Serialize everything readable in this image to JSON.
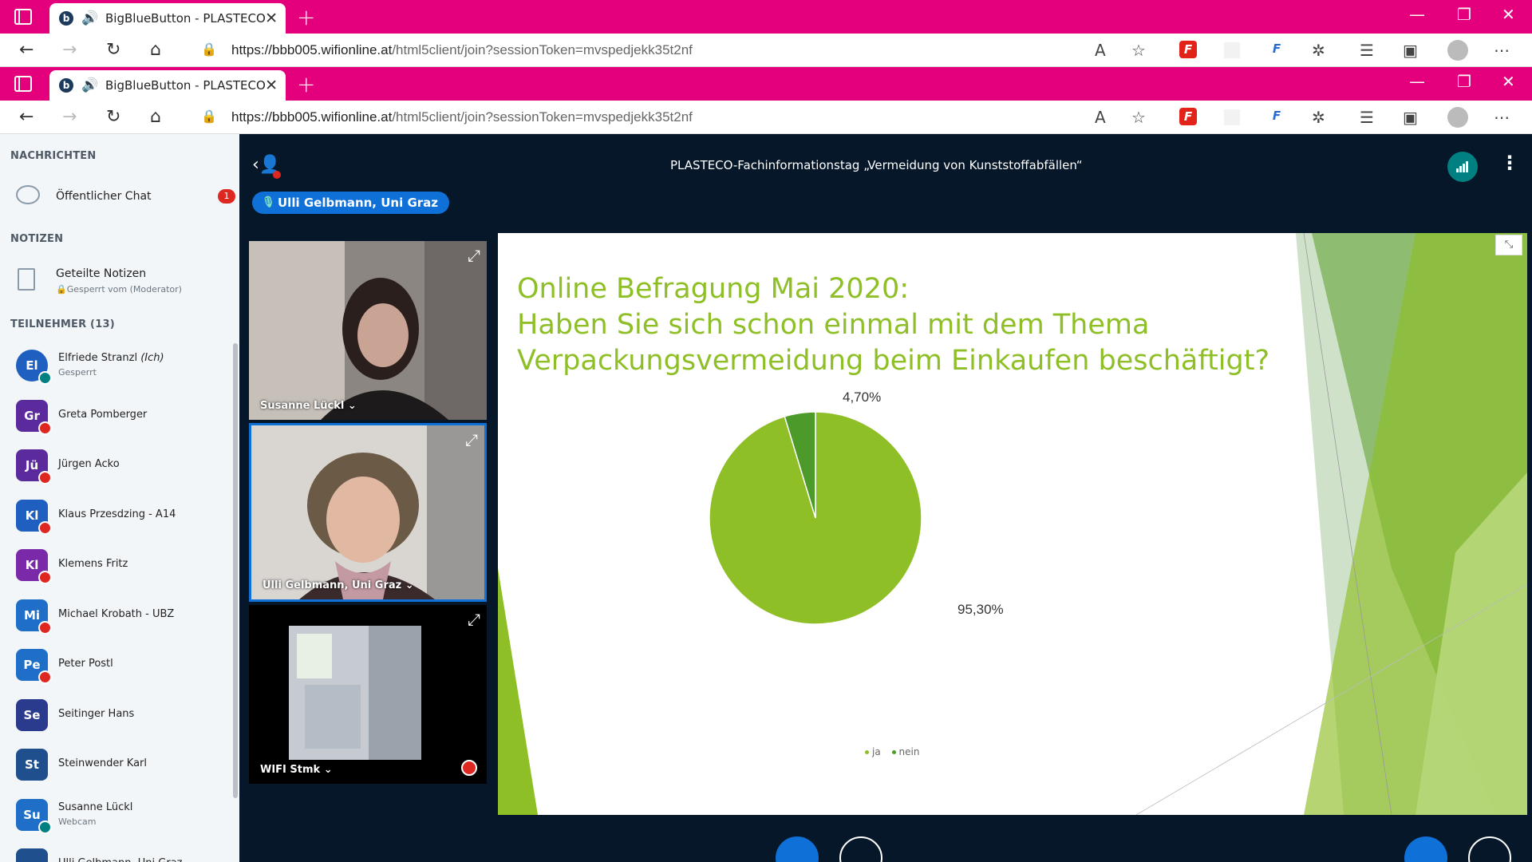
{
  "browser": {
    "tab_title": "BigBlueButton - PLASTECO-",
    "favicon_letter": "b",
    "url_domain": "https://bbb005.wifionline.at",
    "url_path": "/html5client/join?sessionToken=mvspedjekk35t2nf"
  },
  "sidebar": {
    "messages_heading": "NACHRICHTEN",
    "public_chat_label": "Öffentlicher Chat",
    "public_chat_unread": "1",
    "notes_heading": "NOTIZEN",
    "shared_notes_label": "Geteilte Notizen",
    "shared_notes_status": "Gesperrt vom (Moderator)",
    "participants_heading": "TEILNEHMER (13)",
    "participants": [
      {
        "initials": "El",
        "name": "Elfriede Stranzl",
        "suffix": " (Ich)",
        "sub": "Gesperrt",
        "color": "#1f5fbf",
        "shape": "circle",
        "badge": "talk"
      },
      {
        "initials": "Gr",
        "name": "Greta Pomberger",
        "sub": "",
        "color": "#5b2a9c",
        "shape": "square",
        "badge": "mute"
      },
      {
        "initials": "Jü",
        "name": "Jürgen Acko",
        "sub": "",
        "color": "#5b2a9c",
        "shape": "square",
        "badge": "mute"
      },
      {
        "initials": "Kl",
        "name": "Klaus Przesdzing - A14",
        "sub": "",
        "color": "#1f5fbf",
        "shape": "square",
        "badge": "mute"
      },
      {
        "initials": "Kl",
        "name": "Klemens Fritz",
        "sub": "",
        "color": "#7a2aa8",
        "shape": "square",
        "badge": "mute"
      },
      {
        "initials": "Mi",
        "name": "Michael Krobath - UBZ",
        "sub": "",
        "color": "#1f6fc9",
        "shape": "square",
        "badge": "mute"
      },
      {
        "initials": "Pe",
        "name": "Peter Postl",
        "sub": "",
        "color": "#1f6fc9",
        "shape": "square",
        "badge": "mute"
      },
      {
        "initials": "Se",
        "name": "Seitinger Hans",
        "sub": "",
        "color": "#2a3a8c",
        "shape": "square",
        "badge": ""
      },
      {
        "initials": "St",
        "name": "Steinwender Karl",
        "sub": "",
        "color": "#1f4f8c",
        "shape": "square",
        "badge": ""
      },
      {
        "initials": "Su",
        "name": "Susanne Lückl",
        "sub": "Webcam",
        "color": "#1f6fc9",
        "shape": "square",
        "badge": "talk"
      },
      {
        "initials": "",
        "name": "Ulli Gelbmann, Uni Graz",
        "sub": "",
        "color": "#1f4f8c",
        "shape": "square",
        "badge": ""
      }
    ]
  },
  "meeting": {
    "title": "PLASTECO-Fachinformationstag „Vermeidung von Kunststoffabfällen“",
    "talking_indicator": "Ulli Gelbmann, Uni Graz",
    "videos": [
      {
        "name": "Susanne Lückl"
      },
      {
        "name": "Ulli Gelbmann, Uni Graz"
      },
      {
        "name": "WIFI Stmk"
      }
    ]
  },
  "slide": {
    "title_lines": [
      "Online Befragung Mai 2020:",
      "Haben Sie sich schon einmal mit dem Thema",
      "Verpackungsvermeidung beim Einkaufen beschäftigt?"
    ]
  },
  "chart_data": {
    "type": "pie",
    "categories": [
      "ja",
      "nein"
    ],
    "values": [
      95.3,
      4.7
    ],
    "labels": [
      "95,30%",
      "4,70%"
    ],
    "colors": [
      "#8fbf26",
      "#4c9a2a"
    ],
    "title": "",
    "legend": "bottom"
  }
}
